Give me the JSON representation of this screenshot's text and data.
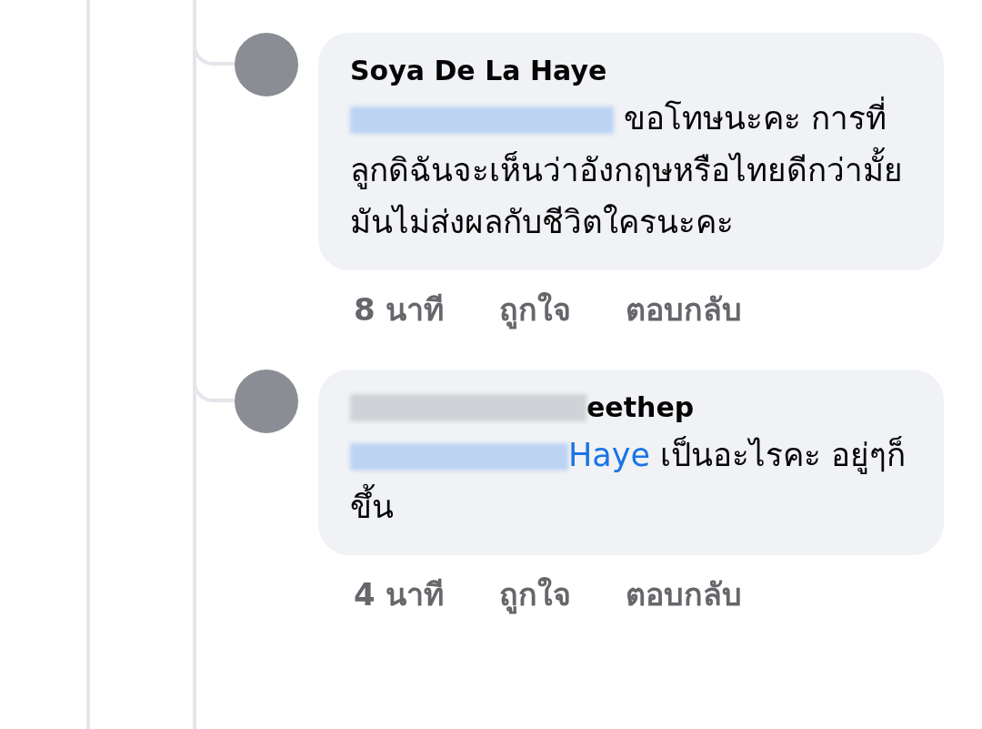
{
  "comments": [
    {
      "author": "Soya De La Haye",
      "author_redacted": false,
      "mention_redacted": true,
      "text": "ขอโทษนะคะ การที่ลูกดิฉันจะเห็นว่าอังกฤษหรือไทยดีกว่ามั้ยมันไม่ส่งผลกับชีวิตใครนะคะ",
      "time": "8 นาที",
      "like": "ถูกใจ",
      "reply": "ตอบกลับ"
    },
    {
      "author": "eethep",
      "author_redacted": true,
      "mention": "Haye",
      "mention_redacted": true,
      "text": "เป็นอะไรคะ อยู่ๆก็ขึ้น",
      "time": "4 นาที",
      "like": "ถูกใจ",
      "reply": "ตอบกลับ"
    }
  ]
}
